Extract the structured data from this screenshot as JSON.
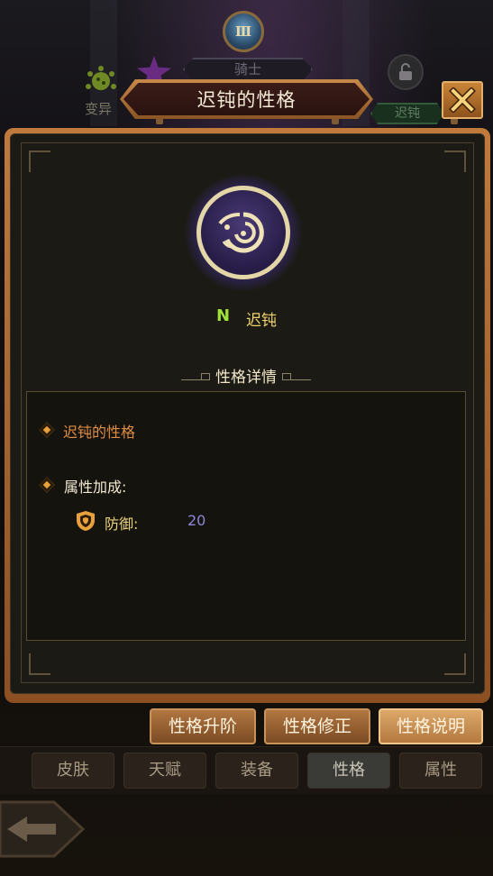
{
  "background": {
    "rank_numeral": "Ⅲ",
    "class_name": "骑士",
    "mutation_label": "变异",
    "trait_tag": "迟钝"
  },
  "dialog": {
    "title": "迟钝的性格",
    "close_label": "X",
    "trait": {
      "rarity": "N",
      "name": "迟钝"
    },
    "section_title": "性格详情",
    "details": {
      "trait_label": "迟钝的性格",
      "attr_label": "属性加成:",
      "attribute": {
        "name": "防御:",
        "value": "20"
      }
    }
  },
  "actions": [
    {
      "label": "性格升阶",
      "active": false
    },
    {
      "label": "性格修正",
      "active": false
    },
    {
      "label": "性格说明",
      "active": true
    }
  ],
  "tabs": [
    {
      "label": "皮肤",
      "active": false
    },
    {
      "label": "天赋",
      "active": false
    },
    {
      "label": "装备",
      "active": false
    },
    {
      "label": "性格",
      "active": true
    },
    {
      "label": "属性",
      "active": false
    }
  ],
  "colors": {
    "accent_orange": "#c07a3c",
    "rarity_green": "#9ee23a",
    "trait_gold": "#efd36a",
    "value_purple": "#8c86d8"
  }
}
